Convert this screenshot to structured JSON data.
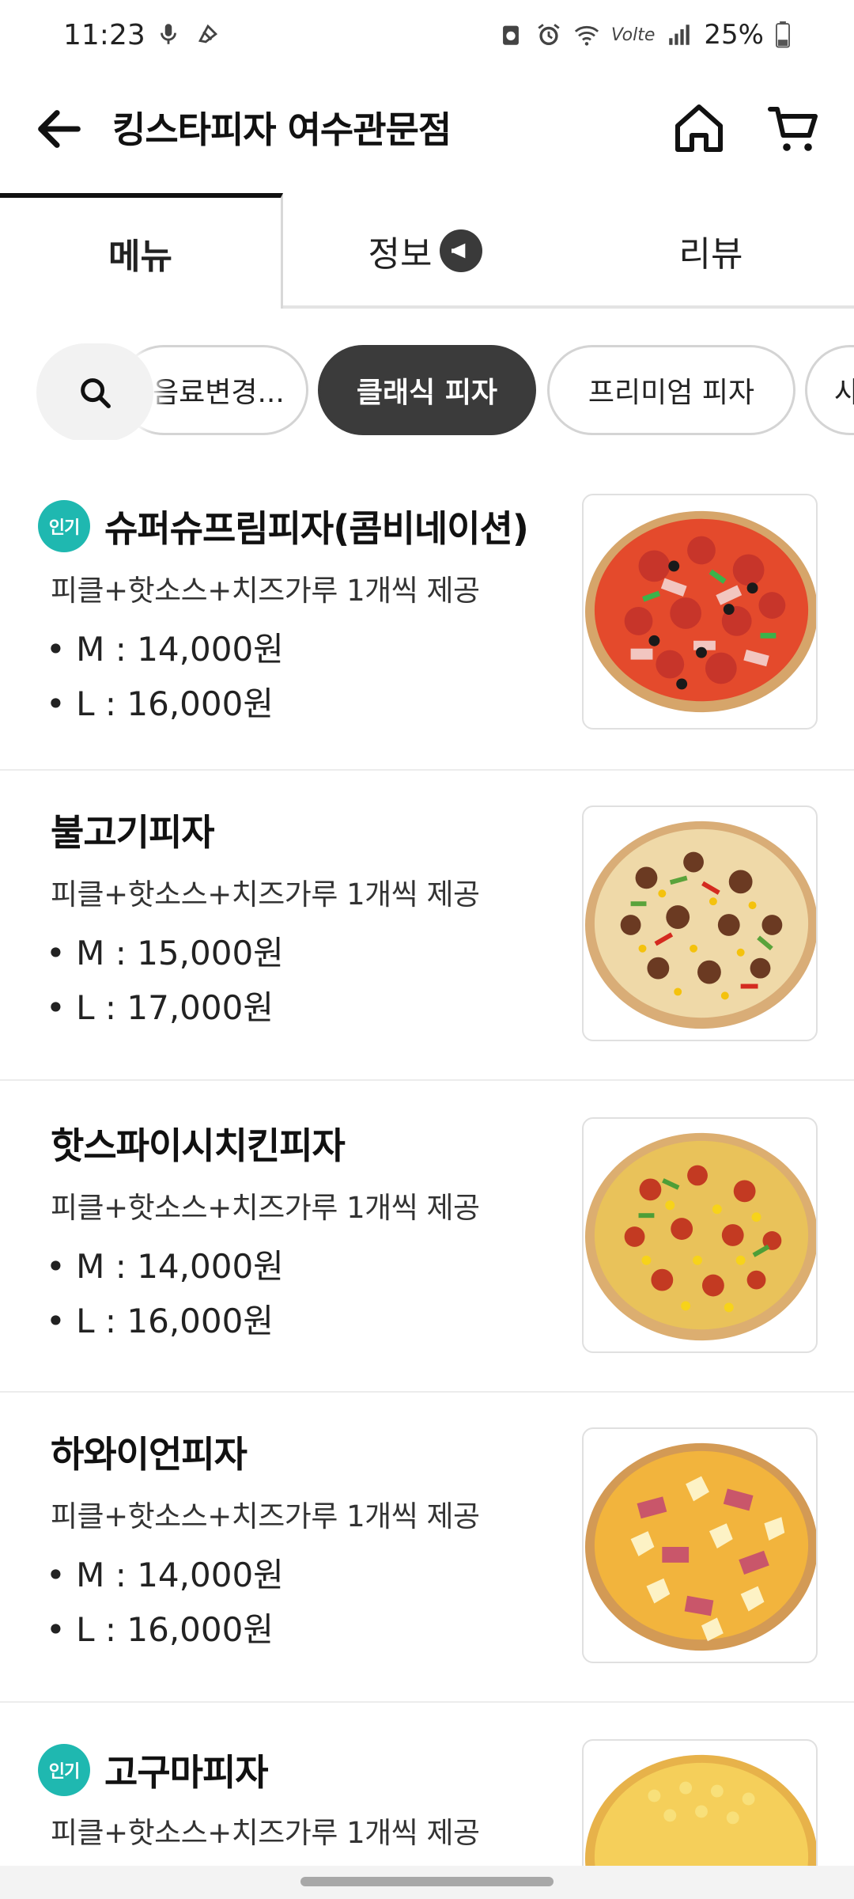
{
  "status_bar": {
    "time": "11:23",
    "battery": "25%",
    "network": "Volte"
  },
  "header": {
    "title": "킹스타피자 여수관문점"
  },
  "tabs": [
    {
      "label": "메뉴",
      "active": true
    },
    {
      "label": "정보"
    },
    {
      "label": "리뷰"
    }
  ],
  "chips": {
    "prev": "음료변경...",
    "active": "클래식 피자",
    "premium": "프리미엄 피자",
    "next": "사"
  },
  "popular_badge_label": "인기",
  "menu": [
    {
      "name": "슈퍼슈프림피자(콤비네이션)",
      "popular": true,
      "desc": "피클+핫소스+치즈가루 1개씩 제공",
      "price_m": "M : 14,000원",
      "price_l": "L : 16,000원",
      "image": "supreme-pizza"
    },
    {
      "name": "불고기피자",
      "popular": false,
      "desc": "피클+핫소스+치즈가루 1개씩 제공",
      "price_m": "M : 15,000원",
      "price_l": "L : 17,000원",
      "image": "bulgogi-pizza"
    },
    {
      "name": "핫스파이시치킨피자",
      "popular": false,
      "desc": "피클+핫소스+치즈가루 1개씩 제공",
      "price_m": "M : 14,000원",
      "price_l": "L : 16,000원",
      "image": "hot-spicy-chicken-pizza"
    },
    {
      "name": "하와이언피자",
      "popular": false,
      "desc": "피클+핫소스+치즈가루 1개씩 제공",
      "price_m": "M : 14,000원",
      "price_l": "L : 16,000원",
      "image": "hawaiian-pizza"
    },
    {
      "name": "고구마피자",
      "popular": true,
      "desc": "피클+핫소스+치즈가루 1개씩 제공",
      "image": "sweet-potato-pizza"
    }
  ],
  "colors": {
    "popular_badge": "#1fb8b0",
    "active_chip": "#3b3b3b",
    "tab_indicator": "#111111"
  },
  "icons": [
    "back-arrow-icon",
    "home-icon",
    "cart-icon",
    "search-icon",
    "megaphone-icon"
  ]
}
